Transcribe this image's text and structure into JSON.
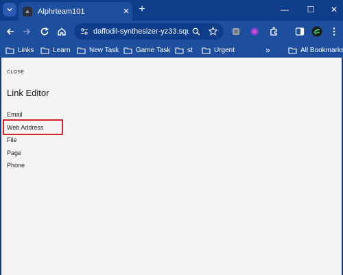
{
  "browser": {
    "tab_title": "Alphrteam101",
    "tab_close_glyph": "✕",
    "new_tab_glyph": "+",
    "window_controls": {
      "minimize": "—",
      "maximize": "☐",
      "close": "✕"
    },
    "url": "daffodil-synthesizer-yz33.squ...",
    "accent_color": "#0f3d8a",
    "toolbar_color": "#1d4f9e"
  },
  "bookmarks": {
    "items": [
      {
        "label": "Links"
      },
      {
        "label": "Learn"
      },
      {
        "label": "New Task"
      },
      {
        "label": "Game Task"
      },
      {
        "label": "st"
      },
      {
        "label": "Urgent"
      }
    ],
    "overflow_glyph": "»",
    "all_bookmarks": "All Bookmarks"
  },
  "editor": {
    "close_label": "CLOSE",
    "title": "Link Editor",
    "options": [
      {
        "label": "Email"
      },
      {
        "label": "Web Address"
      },
      {
        "label": "File"
      },
      {
        "label": "Page"
      },
      {
        "label": "Phone"
      }
    ],
    "highlight_color": "#d0202a"
  }
}
